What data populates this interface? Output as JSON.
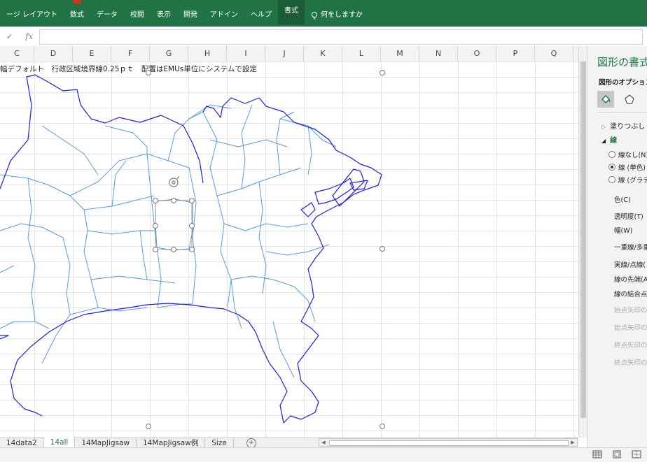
{
  "ribbon": {
    "tabs": [
      "ージ レイアウト",
      "数式",
      "データ",
      "校閲",
      "表示",
      "開発",
      "アドイン",
      "ヘルプ",
      "書式"
    ],
    "active_tab": "書式",
    "tell_me": "何をしますか",
    "tell_me_icon": "lightbulb-icon"
  },
  "formula_bar": {
    "cancel_icon": "check-icon",
    "fx_label": "fx",
    "value": ""
  },
  "columns": [
    "C",
    "D",
    "E",
    "F",
    "G",
    "H",
    "I",
    "J",
    "K",
    "L",
    "M",
    "N",
    "O",
    "P",
    "Q"
  ],
  "cell_text": "幅デフォルト　行政区域境界線0.25ｐｔ　配置はEMUs単位にシステムで設定",
  "format_pane": {
    "title": "図形の書式",
    "subtitle": "図形のオプション",
    "sections": {
      "fill": "塗りつぶし",
      "line": "線"
    },
    "line_options": [
      {
        "label": "線なし(N)",
        "selected": false
      },
      {
        "label": "線 (単色)",
        "selected": true
      },
      {
        "label": "線 (グラデ",
        "selected": false
      }
    ],
    "properties": [
      "色(C)",
      "透明度(T)",
      "幅(W)",
      "一重線/多重",
      "実線/点線(",
      "線の先端(A",
      "線の結合点("
    ],
    "disabled_properties": [
      "始点矢印の種",
      "始点矢印のサ",
      "終点矢印の種",
      "終点矢印のサ"
    ]
  },
  "sheet_tabs": [
    "14data2",
    "14all",
    "14MapJigsaw",
    "14MapJigsaw例",
    "Size"
  ],
  "active_sheet": "14all",
  "colors": {
    "ribbon": "#217346",
    "coastline": "#1f1fd8",
    "boundaries": "#5b9bd5"
  }
}
